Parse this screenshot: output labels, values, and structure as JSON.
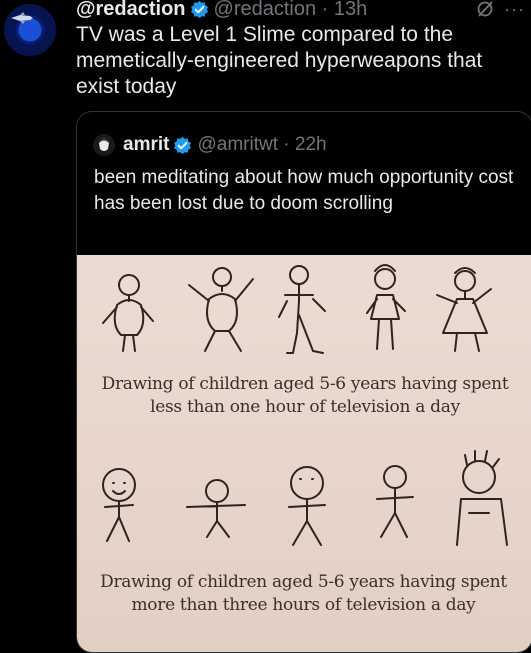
{
  "tweet": {
    "author_name": "@redaction",
    "author_handle": "@redaction",
    "time": "13h",
    "text": "TV was a Level 1 Slime compared to the memetically-engineered hyperweapons that exist today"
  },
  "quote": {
    "author_name": "amrit",
    "author_handle": "@amritwt",
    "time": "22h",
    "text": "been meditating about how much opportunity cost has been lost due to doom scrolling"
  },
  "image": {
    "caption_top": "Drawing of children aged 5-6 years having spent less than one hour of television a day",
    "caption_bottom": "Drawing of children aged 5-6 years having spent more than three hours of television a day"
  },
  "colors": {
    "verified": "#1d9bf0",
    "muted": "#71767b",
    "text": "#e7e9ea",
    "photo_bg": "#e8d6cc"
  },
  "icons": [
    "verified-badge-icon",
    "grok-icon",
    "more-icon"
  ]
}
